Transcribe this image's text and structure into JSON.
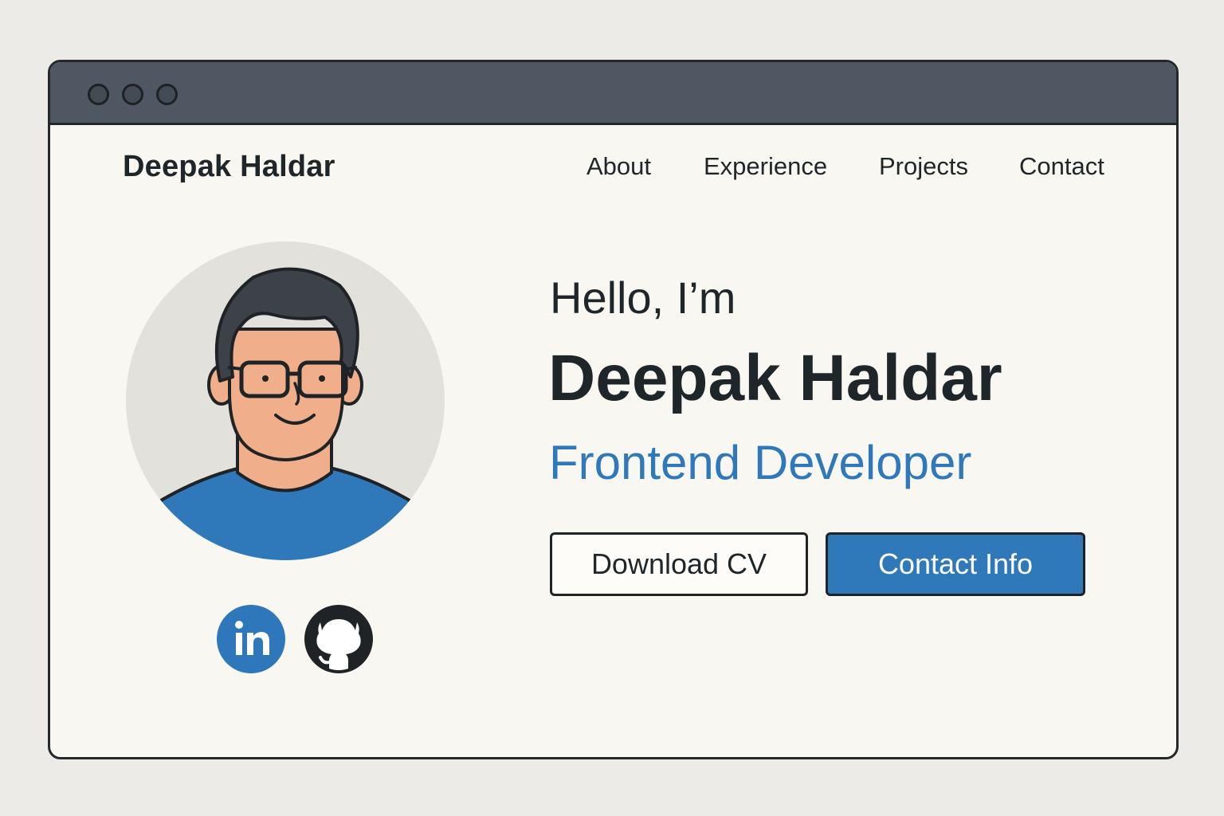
{
  "header": {
    "brand": "Deepak Haldar",
    "nav": [
      "About",
      "Experience",
      "Projects",
      "Contact"
    ]
  },
  "hero": {
    "greeting": "Hello, I’m",
    "name": "Deepak Haldar",
    "role": "Frontend Developer",
    "buttons": {
      "download_cv": "Download CV",
      "contact_info": "Contact Info"
    }
  },
  "social": {
    "linkedin_icon": "linkedin-icon",
    "github_icon": "github-icon"
  },
  "colors": {
    "accent": "#2f78ba",
    "text": "#1f2629",
    "background": "#f9f7f2",
    "titlebar": "#4f5862"
  }
}
